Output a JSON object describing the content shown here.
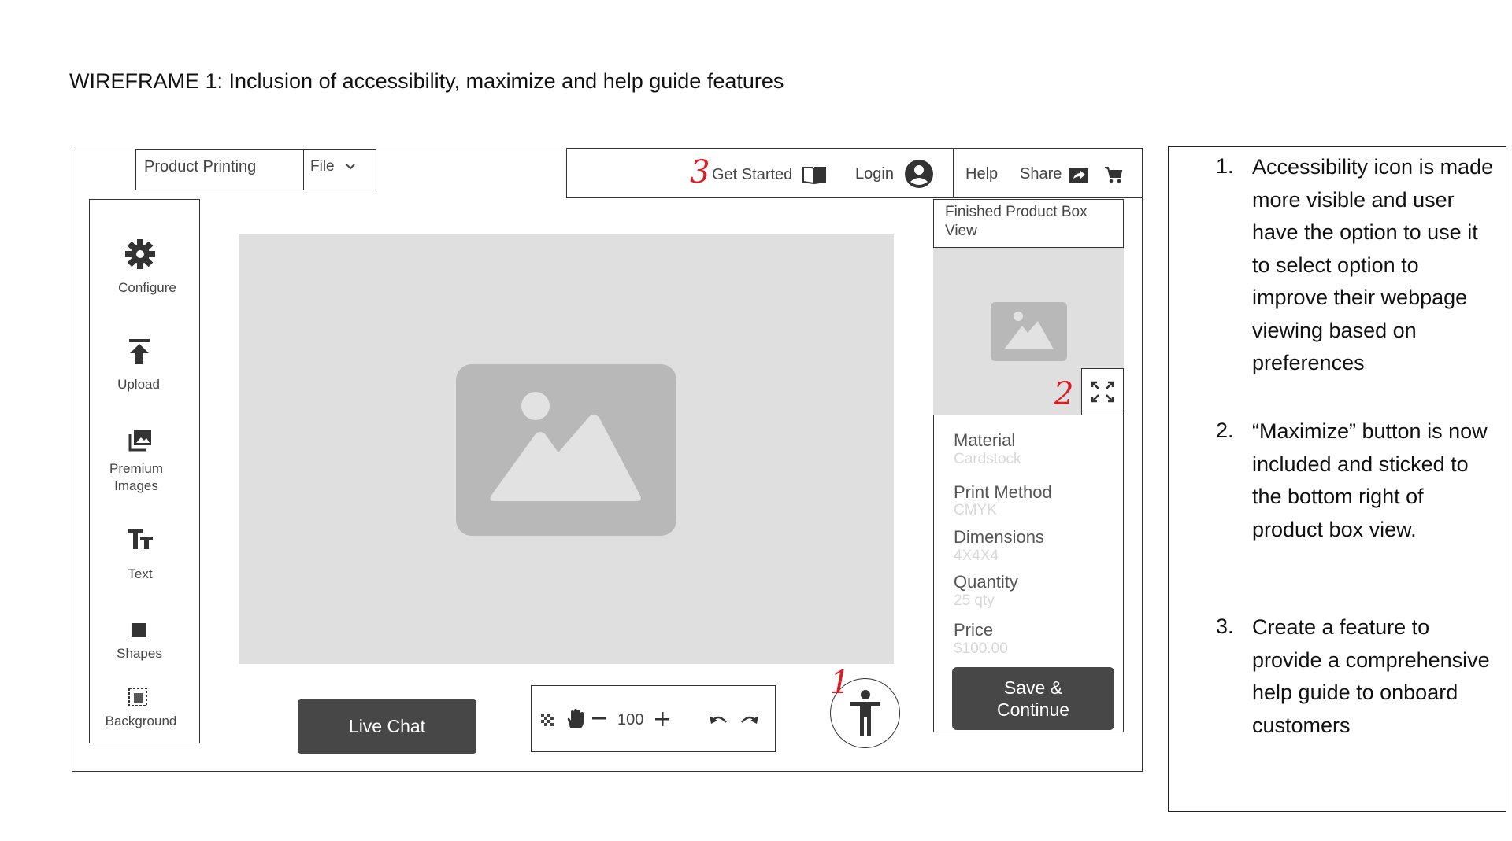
{
  "page_title": "WIREFRAME 1: Inclusion of accessibility, maximize and help guide features",
  "header": {
    "product_label": "Product Printing",
    "file_menu": "File",
    "get_started": "Get Started",
    "login": "Login",
    "help": "Help",
    "share": "Share"
  },
  "sidebar": {
    "items": [
      {
        "label": "Configure",
        "icon": "gear-icon"
      },
      {
        "label": "Upload",
        "icon": "upload-icon"
      },
      {
        "label": "Premium Images",
        "icon": "images-icon"
      },
      {
        "label": "Text",
        "icon": "text-icon"
      },
      {
        "label": "Shapes",
        "icon": "shape-icon"
      },
      {
        "label": "Background",
        "icon": "background-icon"
      }
    ]
  },
  "bottom": {
    "live_chat": "Live Chat",
    "zoom_value": "100"
  },
  "panel": {
    "title": "Finished Product Box View",
    "specs": [
      {
        "label": "Material",
        "value": "Cardstock"
      },
      {
        "label": "Print Method",
        "value": "CMYK"
      },
      {
        "label": "Dimensions",
        "value": "4X4X4"
      },
      {
        "label": "Quantity",
        "value": "25 qty"
      },
      {
        "label": "Price",
        "value": "$100.00"
      }
    ],
    "save_button": "Save & Continue"
  },
  "annotations": {
    "marker_1": "1",
    "marker_2": "2",
    "marker_3": "3"
  },
  "notes": [
    {
      "number": "1.",
      "text": "Accessibility icon is made more visible and user have the option to use it to select option to improve their webpage viewing based on preferences"
    },
    {
      "number": "2.",
      "text": "“Maximize” button is now included and sticked to the bottom right of product box view."
    },
    {
      "number": "3.",
      "text": "Create a feature to provide a comprehensive help guide to onboard customers"
    }
  ],
  "colors": {
    "annotation_red": "#d61f26",
    "button_dark": "#474747",
    "placeholder_grey": "#dfdfdf"
  }
}
